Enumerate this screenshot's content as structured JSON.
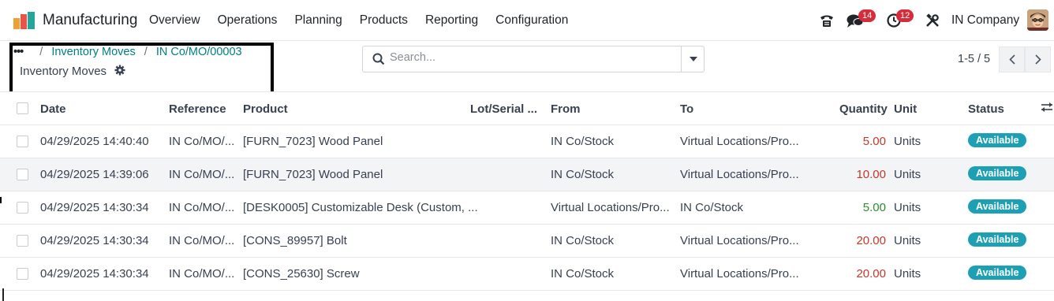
{
  "app": {
    "name": "Manufacturing",
    "menu": [
      "Overview",
      "Operations",
      "Planning",
      "Products",
      "Reporting",
      "Configuration"
    ]
  },
  "systray": {
    "chat_count": "14",
    "activity_count": "12",
    "company": "IN Company"
  },
  "breadcrumb": {
    "parent1": "Inventory Moves",
    "parent2": "IN Co/MO/00003",
    "current": "Inventory Moves"
  },
  "search": {
    "placeholder": "Search..."
  },
  "pager": {
    "value": "1-5 / 5"
  },
  "table": {
    "headers": {
      "date": "Date",
      "reference": "Reference",
      "product": "Product",
      "lot": "Lot/Serial ...",
      "from": "From",
      "to": "To",
      "quantity": "Quantity",
      "unit": "Unit",
      "status": "Status"
    },
    "rows": [
      {
        "date": "04/29/2025 14:40:40",
        "reference": "IN Co/MO/...",
        "product": "[FURN_7023] Wood Panel",
        "lot": "",
        "from": "IN Co/Stock",
        "to": "Virtual Locations/Pro...",
        "quantity": "5.00",
        "unit": "Units",
        "status": "Available"
      },
      {
        "date": "04/29/2025 14:39:06",
        "reference": "IN Co/MO/...",
        "product": "[FURN_7023] Wood Panel",
        "lot": "",
        "from": "IN Co/Stock",
        "to": "Virtual Locations/Pro...",
        "quantity": "10.00",
        "unit": "Units",
        "status": "Available"
      },
      {
        "date": "04/29/2025 14:30:34",
        "reference": "IN Co/MO/...",
        "product": "[DESK0005] Customizable Desk (Custom, ...",
        "lot": "",
        "from": "Virtual Locations/Pro...",
        "to": "IN Co/Stock",
        "quantity": "5.00",
        "unit": "Units",
        "status": "Available"
      },
      {
        "date": "04/29/2025 14:30:34",
        "reference": "IN Co/MO/...",
        "product": "[CONS_89957] Bolt",
        "lot": "",
        "from": "IN Co/Stock",
        "to": "Virtual Locations/Pro...",
        "quantity": "20.00",
        "unit": "Units",
        "status": "Available"
      },
      {
        "date": "04/29/2025 14:30:34",
        "reference": "IN Co/MO/...",
        "product": "[CONS_25630] Screw",
        "lot": "",
        "from": "IN Co/Stock",
        "to": "Virtual Locations/Pro...",
        "quantity": "20.00",
        "unit": "Units",
        "status": "Available"
      }
    ]
  },
  "colors": {
    "link": "#017e84",
    "status_badge": "#1ea0b4",
    "qty_out": "#c0392b",
    "qty_in": "#2e8b2e",
    "notification_badge": "#d62d3a"
  }
}
